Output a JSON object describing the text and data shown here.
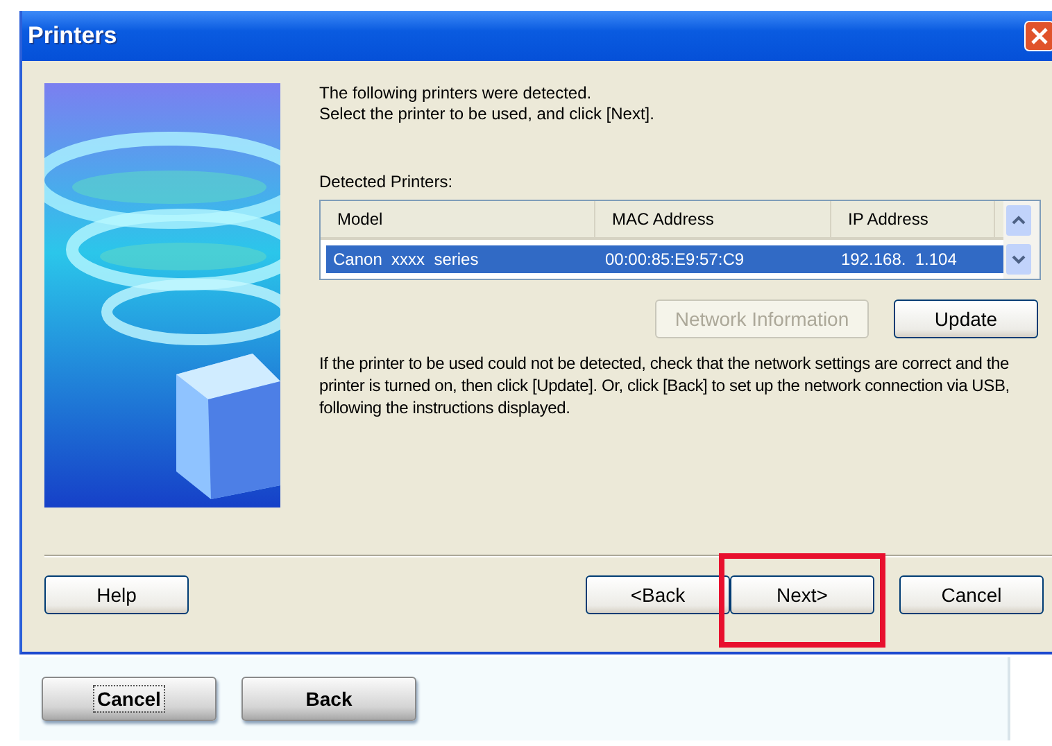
{
  "window": {
    "title": "Printers"
  },
  "intro": [
    "The following printers were detected.",
    "Select the printer to be used, and click [Next]."
  ],
  "printers_label": "Detected Printers:",
  "table": {
    "columns": [
      "Model",
      "MAC Address",
      "IP Address"
    ],
    "rows": [
      {
        "cells": [
          "Canon  xxxx  series",
          "00:00:85:E9:57:C9",
          "192.168.  1.104"
        ],
        "selected": true
      }
    ]
  },
  "side_buttons": [
    {
      "label": "Network Information",
      "disabled": true
    },
    {
      "label": "Update",
      "disabled": false
    }
  ],
  "help_text": "If the printer to be used could not be detected, check that the network settings are correct and the printer is turned on, then click [Update]. Or, click [Back] to set up the network connection via USB, following the instructions displayed.",
  "buttons": [
    {
      "label": "Help",
      "highlighted": false
    },
    {
      "label": "<Back",
      "highlighted": false
    },
    {
      "label": "Next>",
      "highlighted": true
    },
    {
      "label": "Cancel",
      "highlighted": false
    }
  ],
  "lower_buttons": [
    {
      "label": "Cancel",
      "focused": true
    },
    {
      "label": "Back",
      "focused": false
    }
  ]
}
